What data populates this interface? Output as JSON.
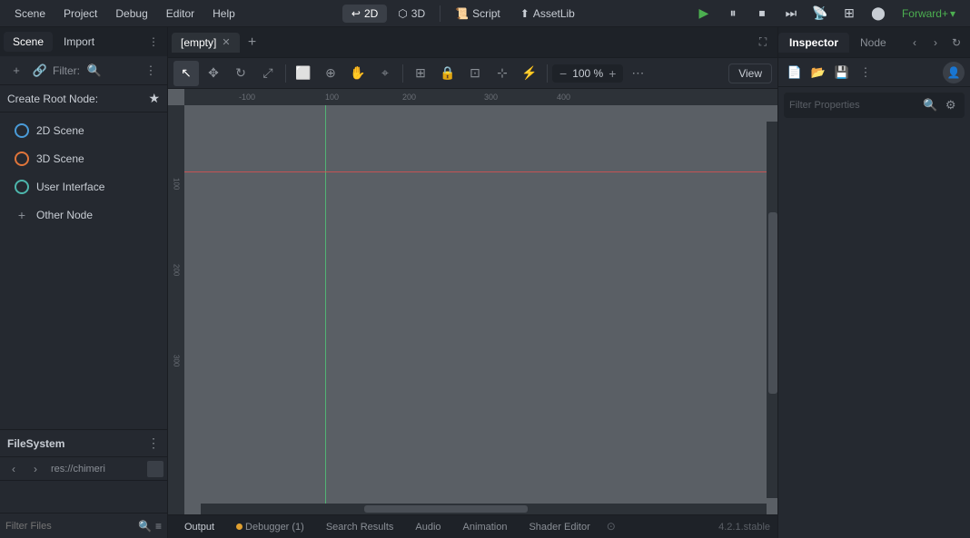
{
  "menu": {
    "items": [
      "Scene",
      "Project",
      "Debug",
      "Editor",
      "Help"
    ]
  },
  "modes": {
    "2d_label": "2D",
    "3d_label": "3D",
    "script_label": "Script",
    "assetlib_label": "AssetLib"
  },
  "playbar": {
    "play_label": "▶",
    "pause_label": "⏸",
    "stop_label": "⏹",
    "step_label": "⏭",
    "remote_label": "📡",
    "movie_label": "🎬",
    "forward_label": "Forward+",
    "dropdown_label": "▾"
  },
  "scene_panel": {
    "tab_scene": "Scene",
    "tab_import": "Import",
    "create_root_label": "Create Root Node:"
  },
  "nodes": [
    {
      "label": "2D Scene",
      "icon_type": "blue"
    },
    {
      "label": "3D Scene",
      "icon_type": "orange"
    },
    {
      "label": "User Interface",
      "icon_type": "teal"
    },
    {
      "label": "Other Node",
      "icon_type": "plus"
    }
  ],
  "filesystem": {
    "title": "FileSystem",
    "path": "res://chimeri"
  },
  "editor_tab": {
    "label": "[empty]"
  },
  "viewport": {
    "zoom": "100 %"
  },
  "inspector": {
    "tab_inspector": "Inspector",
    "tab_node": "Node",
    "filter_placeholder": "Filter Properties"
  },
  "bottom_tabs": {
    "output": "Output",
    "debugger": "Debugger",
    "debugger_count": "(1)",
    "search_results": "Search Results",
    "audio": "Audio",
    "animation": "Animation",
    "shader_editor": "Shader Editor"
  },
  "version": "4.2.1.stable"
}
